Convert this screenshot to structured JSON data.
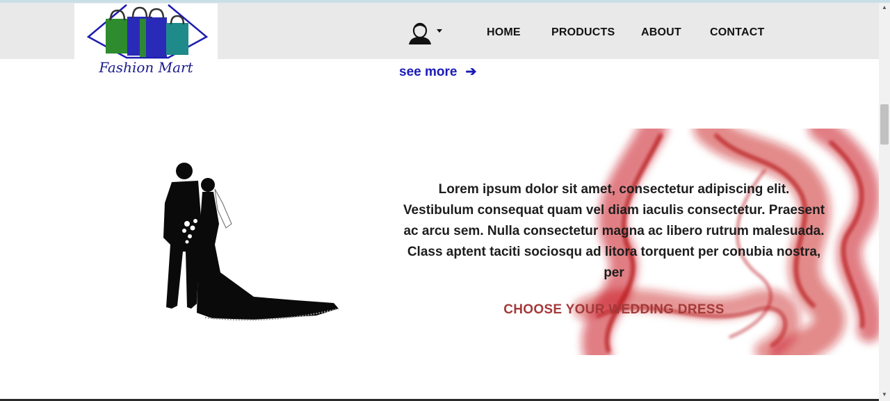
{
  "brand": {
    "name": "Fashion Mart",
    "logo_icon": "shopping-bags-icon"
  },
  "nav": {
    "user_icon": "user-avatar-icon",
    "dropdown_icon": "caret-down-icon",
    "links": [
      "HOME",
      "PRODUCTS",
      "ABOUT",
      "CONTACT"
    ]
  },
  "see_more": {
    "label": "see more",
    "icon": "arrow-right-icon"
  },
  "feature": {
    "image": "wedding-couple-silhouette",
    "description": "Lorem ipsum dolor sit amet, consectetur adipiscing elit. Vestibulum consequat quam vel diam iaculis consectetur. Praesent ac arcu sem. Nulla consectetur magna ac libero rutrum malesuada. Class aptent taciti sociosqu ad litora torquent per conubia nostra, per",
    "cta": "CHOOSE YOUR WEDDING DRESS",
    "background": "red-smoke"
  },
  "colors": {
    "accent": "#1a1ab8",
    "cta": "#a33a3a",
    "navbar": "#e9e9e9",
    "smoke": "#c8101c"
  }
}
